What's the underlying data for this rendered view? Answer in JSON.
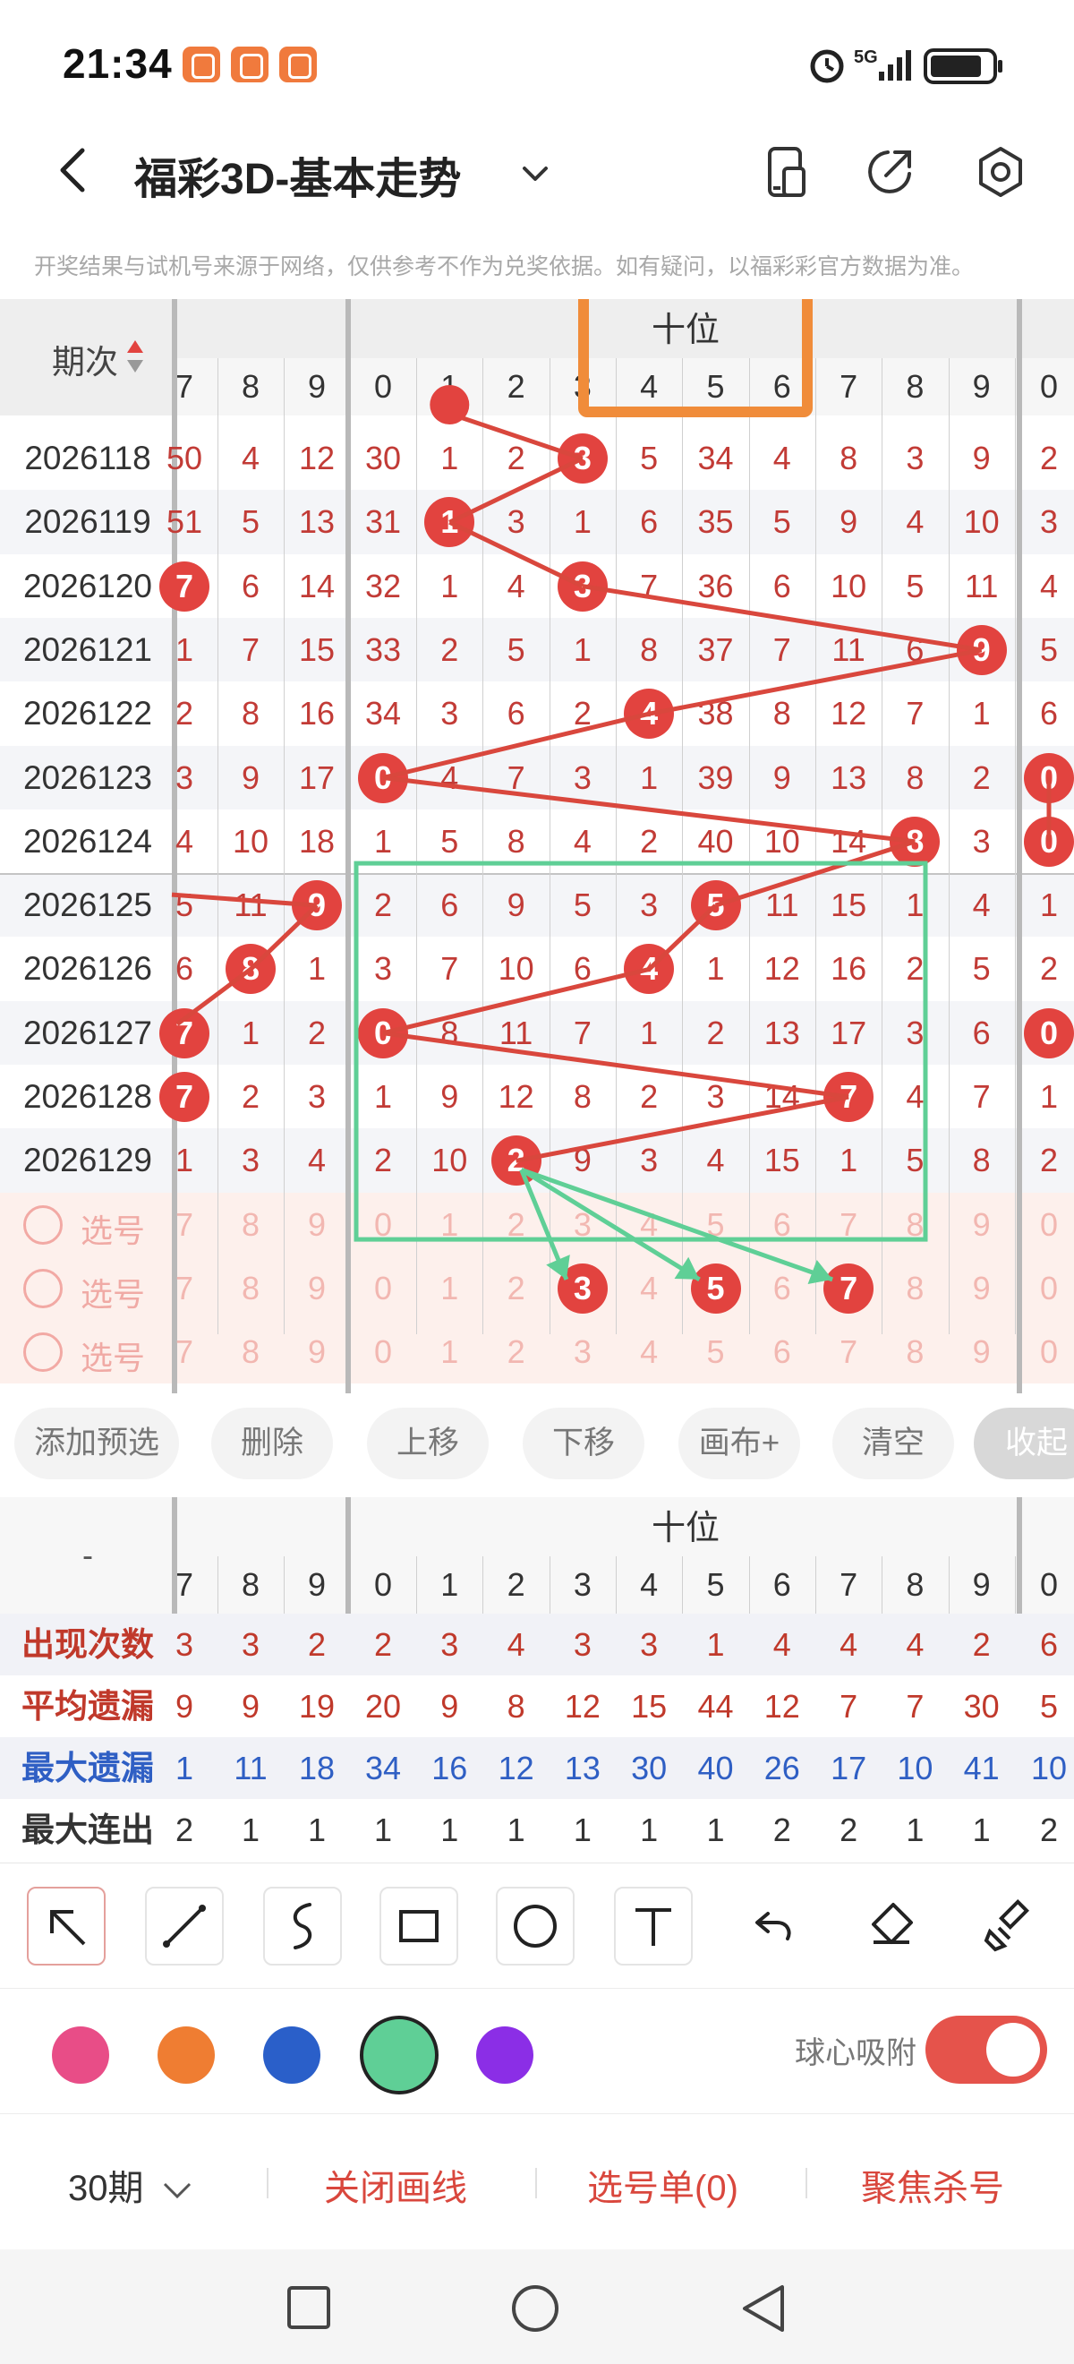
{
  "status_bar": {
    "time": "21:34",
    "network": "5G"
  },
  "header": {
    "title": "福彩3D-基本走势",
    "back_icon": "back-arrow-icon",
    "dropdown_icon": "chevron-down-icon",
    "icons": [
      "phone-split-icon",
      "share-icon",
      "settings-icon"
    ]
  },
  "notice": "开奖结果与试机号来源于网络，仅供参考不作为兑奖依据。如有疑问，以福彩彩官方数据为准。",
  "table": {
    "issue_header": "期次",
    "group_label": "十位",
    "left_digits": [
      "7",
      "8",
      "9"
    ],
    "digits": [
      "0",
      "1",
      "2",
      "3",
      "4",
      "5",
      "6",
      "7",
      "8",
      "9"
    ],
    "right_digit": "0",
    "rows": [
      {
        "issue": "2026118",
        "left": [
          "50",
          "4",
          "12"
        ],
        "cells": [
          "30",
          "1",
          "2",
          "3",
          "5",
          "34",
          "4",
          "8",
          "3",
          "9"
        ],
        "hit": 3,
        "right": "2"
      },
      {
        "issue": "2026119",
        "left": [
          "51",
          "5",
          "13"
        ],
        "cells": [
          "31",
          "1",
          "3",
          "1",
          "6",
          "35",
          "5",
          "9",
          "4",
          "10"
        ],
        "hit": 1,
        "right": "3"
      },
      {
        "issue": "2026120",
        "left": [
          "7",
          "6",
          "14"
        ],
        "cells": [
          "32",
          "1",
          "4",
          "3",
          "7",
          "36",
          "6",
          "10",
          "5",
          "11"
        ],
        "hit": 3,
        "left_hit": 0,
        "right": "4"
      },
      {
        "issue": "2026121",
        "left": [
          "1",
          "7",
          "15"
        ],
        "cells": [
          "33",
          "2",
          "5",
          "1",
          "8",
          "37",
          "7",
          "11",
          "6",
          "9"
        ],
        "hit": 9,
        "right": "5"
      },
      {
        "issue": "2026122",
        "left": [
          "2",
          "8",
          "16"
        ],
        "cells": [
          "34",
          "3",
          "6",
          "2",
          "4",
          "38",
          "8",
          "12",
          "7",
          "1"
        ],
        "hit": 4,
        "right": "6"
      },
      {
        "issue": "2026123",
        "left": [
          "3",
          "9",
          "17"
        ],
        "cells": [
          "0",
          "4",
          "7",
          "3",
          "1",
          "39",
          "9",
          "13",
          "8",
          "2"
        ],
        "hit": 0,
        "right": "0",
        "right_hit": true
      },
      {
        "issue": "2026124",
        "left": [
          "4",
          "10",
          "18"
        ],
        "cells": [
          "1",
          "5",
          "8",
          "4",
          "2",
          "40",
          "10",
          "14",
          "8",
          "3"
        ],
        "hit": 8,
        "right": "0",
        "right_hit": true
      },
      {
        "issue": "2026125",
        "left": [
          "5",
          "11",
          "9"
        ],
        "cells": [
          "2",
          "6",
          "9",
          "5",
          "3",
          "5",
          "11",
          "15",
          "1",
          "4"
        ],
        "hit": 5,
        "left_hit": 2,
        "right": "1"
      },
      {
        "issue": "2026126",
        "left": [
          "6",
          "8",
          "1"
        ],
        "cells": [
          "3",
          "7",
          "10",
          "6",
          "4",
          "1",
          "12",
          "16",
          "2",
          "5"
        ],
        "hit": 4,
        "left_hit": 1,
        "right": "2"
      },
      {
        "issue": "2026127",
        "left": [
          "7",
          "1",
          "2"
        ],
        "cells": [
          "0",
          "8",
          "11",
          "7",
          "1",
          "2",
          "13",
          "17",
          "3",
          "6"
        ],
        "hit": 0,
        "left_hit": 0,
        "right": "0",
        "right_hit": true
      },
      {
        "issue": "2026128",
        "left": [
          "7",
          "2",
          "3"
        ],
        "cells": [
          "1",
          "9",
          "12",
          "8",
          "2",
          "3",
          "14",
          "7",
          "4",
          "7"
        ],
        "hit": 7,
        "left_hit": 0,
        "right": "1"
      },
      {
        "issue": "2026129",
        "left": [
          "1",
          "3",
          "4"
        ],
        "cells": [
          "2",
          "10",
          "2",
          "9",
          "3",
          "4",
          "15",
          "1",
          "5",
          "8"
        ],
        "hit": 2,
        "right": "2"
      }
    ],
    "pick_label": "选号",
    "pick_rows": [
      {
        "hits": []
      },
      {
        "hits": [
          3,
          5,
          7
        ]
      },
      {
        "hits": []
      }
    ]
  },
  "actions": [
    "添加预选",
    "删除",
    "上移",
    "下移",
    "画布+",
    "清空",
    "收起"
  ],
  "stats": {
    "group_label": "十位",
    "corner": "-",
    "rows": [
      {
        "label": "出现次数",
        "color": "#c0392b",
        "left": [
          "3",
          "3",
          "2"
        ],
        "cells": [
          "2",
          "3",
          "4",
          "3",
          "3",
          "1",
          "4",
          "4",
          "4",
          "2"
        ],
        "right": "6"
      },
      {
        "label": "平均遗漏",
        "color": "#c0392b",
        "left": [
          "9",
          "9",
          "19"
        ],
        "cells": [
          "20",
          "9",
          "8",
          "12",
          "15",
          "44",
          "12",
          "7",
          "7",
          "30"
        ],
        "right": "5"
      },
      {
        "label": "最大遗漏",
        "color": "#2f5fc4",
        "left": [
          "1",
          "11",
          "18"
        ],
        "cells": [
          "34",
          "16",
          "12",
          "13",
          "30",
          "40",
          "26",
          "17",
          "10",
          "41"
        ],
        "right": "10"
      },
      {
        "label": "最大连出",
        "color": "#333333",
        "left": [
          "2",
          "1",
          "1"
        ],
        "cells": [
          "1",
          "1",
          "1",
          "1",
          "1",
          "1",
          "2",
          "2",
          "1",
          "1"
        ],
        "right": "2"
      }
    ]
  },
  "tools": [
    "arrow-tool-icon",
    "line-tool-icon",
    "curve-tool-icon",
    "rectangle-tool-icon",
    "circle-tool-icon",
    "text-tool-icon",
    "undo-icon",
    "eraser-icon",
    "clear-brush-icon"
  ],
  "colors": [
    "#e84d87",
    "#ef7d32",
    "#2a5fc9",
    "#5fcf96",
    "#8b2ee6"
  ],
  "selected_color": "#5fcf96",
  "snap_label": "球心吸附",
  "snap_on": true,
  "bottom": {
    "period": "30期",
    "close_draw": "关闭画线",
    "pick_list": "选号单(0)",
    "focus_kill": "聚焦杀号"
  },
  "navbar": [
    "square-icon",
    "circle-icon",
    "triangle-back-icon"
  ]
}
